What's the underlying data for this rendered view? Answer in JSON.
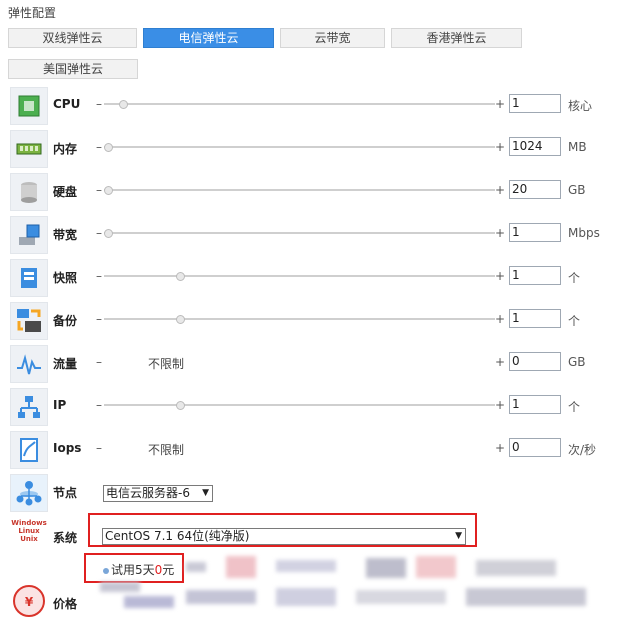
{
  "section_title": "弹性配置",
  "tabs": [
    {
      "label": "双线弹性云",
      "active": false
    },
    {
      "label": "电信弹性云",
      "active": true
    },
    {
      "label": "云带宽",
      "active": false
    },
    {
      "label": "香港弹性云",
      "active": false
    },
    {
      "label": "美国弹性云",
      "active": false
    }
  ],
  "resources": [
    {
      "name": "CPU",
      "value": "1",
      "unit": "核心",
      "icon": "cpu-icon",
      "slider_level": 0.04
    },
    {
      "name": "内存",
      "value": "1024",
      "unit": "MB",
      "icon": "memory-icon",
      "slider_level": 0.0
    },
    {
      "name": "硬盘",
      "value": "20",
      "unit": "GB",
      "icon": "disk-icon",
      "slider_level": 0.0
    },
    {
      "name": "带宽",
      "value": "1",
      "unit": "Mbps",
      "icon": "bandwidth-icon",
      "slider_level": 0.0
    },
    {
      "name": "快照",
      "value": "1",
      "unit": "个",
      "icon": "snapshot-icon",
      "slider_level": 0.19
    },
    {
      "name": "备份",
      "value": "1",
      "unit": "个",
      "icon": "backup-icon",
      "slider_level": 0.19
    },
    {
      "name": "流量",
      "value": "0",
      "unit": "GB",
      "icon": "traffic-icon",
      "unlimited_text": "不限制"
    },
    {
      "name": "IP",
      "value": "1",
      "unit": "个",
      "icon": "ip-icon",
      "slider_level": 0.19
    },
    {
      "name": "Iops",
      "value": "0",
      "unit": "次/秒",
      "icon": "iops-icon",
      "unlimited_text": "不限制"
    }
  ],
  "node": {
    "label": "节点",
    "selected": "电信云服务器-6"
  },
  "system": {
    "label": "系统",
    "selected": "CentOS 7.1 64位(纯净版)",
    "logo_lines": [
      "Windows",
      "Linux",
      "Unix"
    ]
  },
  "trial": {
    "prefix": "试用5天",
    "price": "0",
    "suffix": "元"
  },
  "price": {
    "label": "价格"
  },
  "colors": {
    "accent": "#3a8ee6",
    "highlight_red": "#e02020",
    "trial_price": "#e02020"
  }
}
